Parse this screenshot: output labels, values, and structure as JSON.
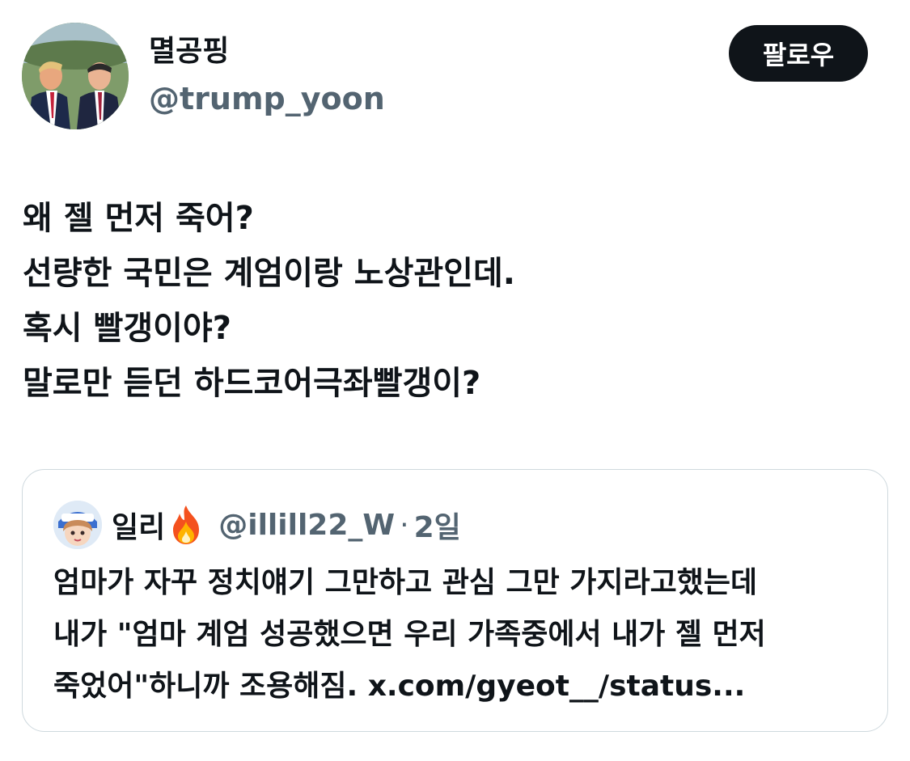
{
  "author": {
    "display_name": "멸공핑",
    "handle": "@trump_yoon",
    "avatar_icon": "profile-photo"
  },
  "follow_button": {
    "label": "팔로우",
    "bg_color": "#0f1419",
    "text_color": "#ffffff"
  },
  "tweet": {
    "lines": [
      "왜 젤 먼저 죽어?",
      "선량한 국민은 계엄이랑 노상관인데.",
      "혹시 빨갱이야?",
      "말로만 듣던 하드코어극좌빨갱이?"
    ]
  },
  "quote": {
    "display_name": "일리",
    "emoji_icon": "fire-icon",
    "handle": "@illill22_W",
    "separator": "·",
    "time": "2일",
    "lines": [
      "엄마가 자꾸 정치얘기 그만하고 관심 그만 가지라고했는데",
      "내가 \"엄마 계엄 성공했으면 우리 가족중에서 내가 젤 먼저",
      "죽었어\"하니까 조용해짐. x.com/gyeot__/status..."
    ]
  },
  "colors": {
    "text_primary": "#0f1419",
    "text_secondary": "#536471",
    "border": "#cfd9de"
  }
}
